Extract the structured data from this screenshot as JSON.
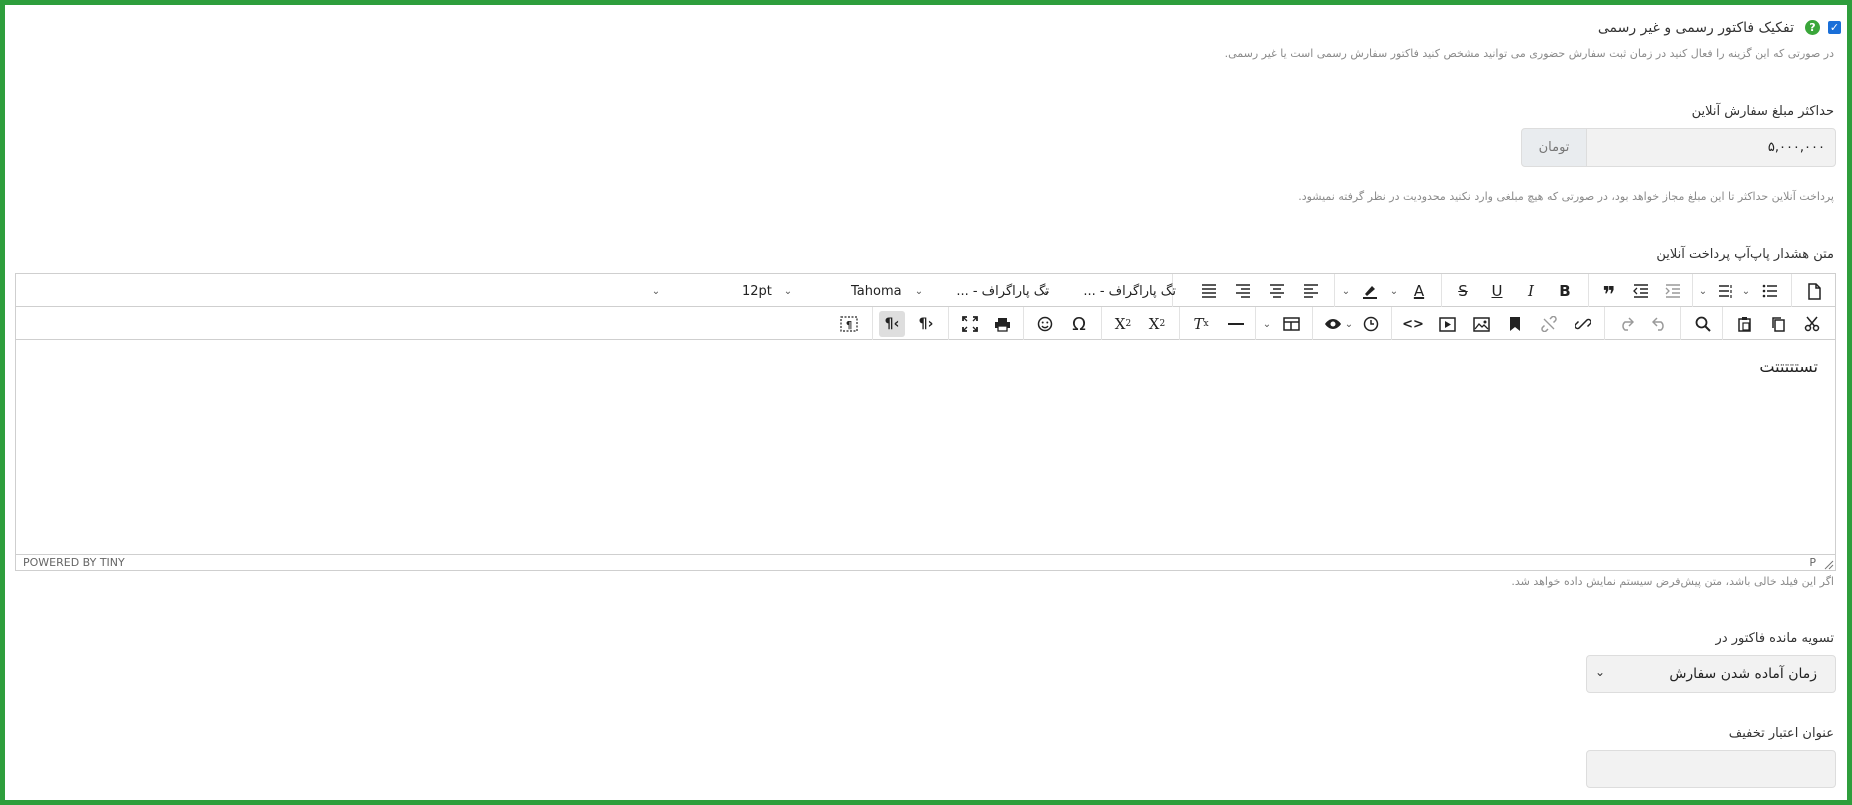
{
  "form": {
    "separate_invoice": {
      "checked": "✓",
      "help_icon": "?",
      "label": "تفکیک فاکتور رسمی و غیر رسمی",
      "hint": "در صورتی که این گزینه را فعال کنید در زمان ثبت سفارش حضوری می توانید مشخص کنید فاکتور سفارش رسمی است یا غیر رسمی."
    },
    "max_online_amount": {
      "label": "حداکثر مبلغ سفارش آنلاین",
      "value": "۵,۰۰۰,۰۰۰",
      "unit": "تومان",
      "hint": "پرداخت آنلاین حداکثر تا این مبلغ مجاز خواهد بود، در صورتی که هیچ مبلغی وارد نکنید محدودیت در نظر گرفته نمیشود."
    },
    "popup_warning": {
      "label": "متن هشدار پاپ‌آپ پرداخت آنلاین",
      "hint": "اگر این فیلد خالی باشد، متن پیش‌فرض سیستم نمایش داده خواهد شد."
    },
    "settlement": {
      "label": "تسویه مانده فاکتور در",
      "value": "زمان آماده شدن سفارش"
    },
    "discount_title": {
      "label": "عنوان اعتبار تخفیف",
      "value": ""
    }
  },
  "editor": {
    "content": "تستتتتتت",
    "toolbar1": {
      "paragraph_tag_1": "تگ پاراگراف - ...",
      "paragraph_tag_2": "تگ پاراگراف - ...",
      "font_family": "Tahoma",
      "font_size": "12pt"
    },
    "statusbar": {
      "powered_by": "POWERED BY TINY",
      "path": "P"
    }
  },
  "colors": {
    "frame": "#2e9e3c",
    "checkbox": "#1a6fd8",
    "help": "#3aa63a"
  }
}
